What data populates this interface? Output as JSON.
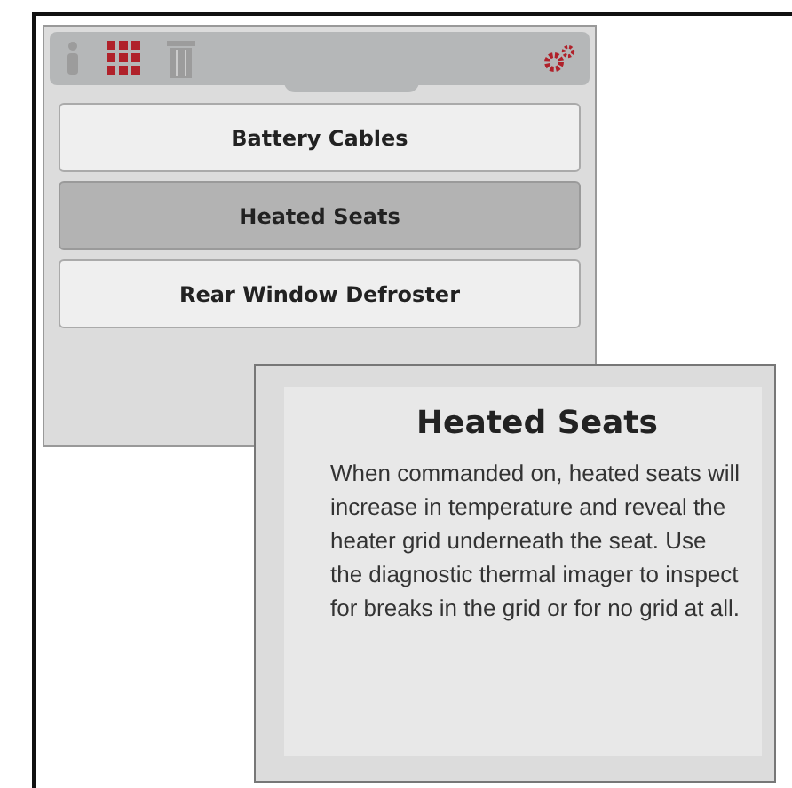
{
  "toolbar": {
    "tools": [
      {
        "kind": "info",
        "selected": false
      },
      {
        "kind": "grid",
        "selected": true
      },
      {
        "kind": "trash",
        "selected": false
      }
    ]
  },
  "items": [
    {
      "label": "Battery Cables",
      "selected": false
    },
    {
      "label": "Heated Seats",
      "selected": true
    },
    {
      "label": "Rear Window Defroster",
      "selected": false
    }
  ],
  "popup": {
    "title": "Heated Seats",
    "body": "When commanded on, heated seats will increase in temperature and reveal the heater grid underneath the seat. Use the diagnostic thermal imager to inspect for breaks in the grid or for no grid at all."
  }
}
